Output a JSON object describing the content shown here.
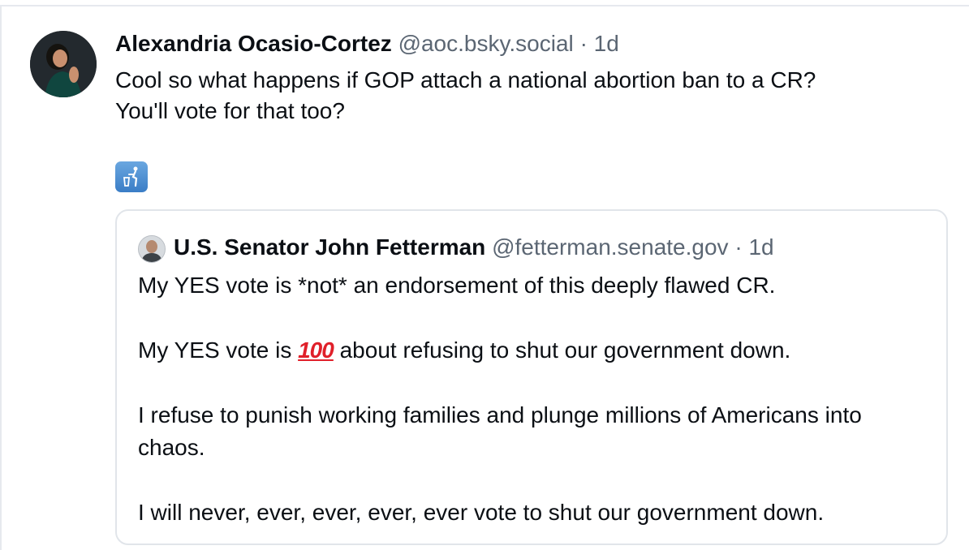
{
  "post": {
    "author_name": "Alexandria Ocasio-Cortez",
    "author_handle": "@aoc.bsky.social",
    "separator": "·",
    "time": "1d",
    "text_lines": [
      "Cool so what happens if GOP attach a national abortion ban to a CR?",
      "You'll vote for that too?"
    ],
    "emoji_icon": "wastebasket-emoji-icon"
  },
  "quote": {
    "author_name": "U.S. Senator John Fetterman",
    "author_handle": "@fetterman.senate.gov",
    "separator": "·",
    "time": "1d",
    "paragraph1": "My YES vote is *not* an endorsement of this deeply flawed CR.",
    "paragraph2_before": "My YES vote is",
    "paragraph2_emoji": "100",
    "paragraph2_after": "about refusing to shut our government down.",
    "paragraph3": "I refuse to punish working families and plunge millions of Americans into chaos.",
    "paragraph4": "I will never, ever, ever, ever, ever vote to shut our government down."
  },
  "colors": {
    "text": "#0b0f14",
    "muted": "#5b6673",
    "border": "#e1e5ea",
    "emoji_red": "#e0202a"
  }
}
